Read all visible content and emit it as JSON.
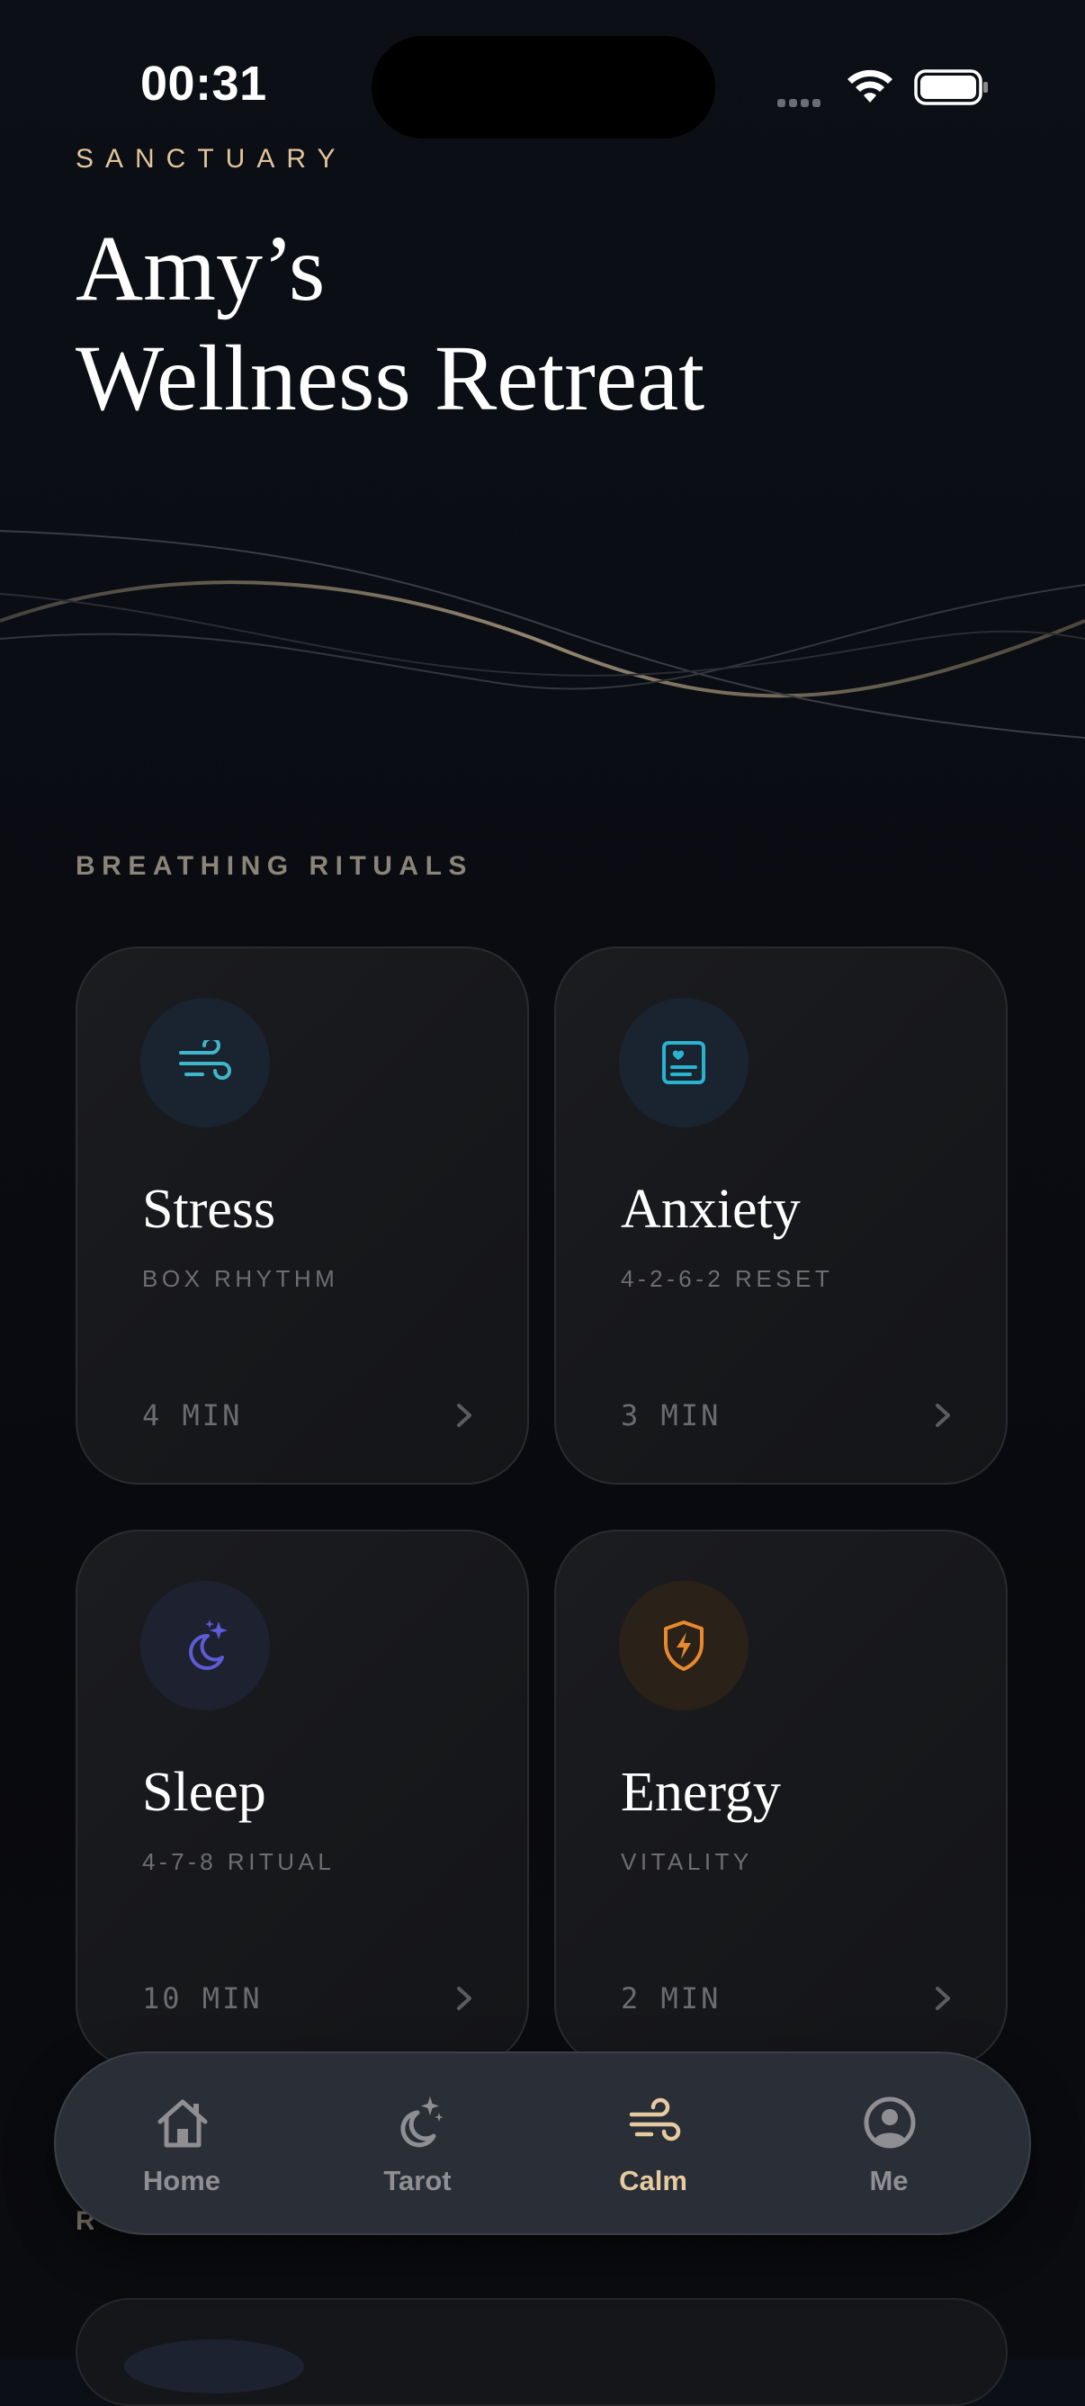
{
  "status_bar": {
    "time": "00:31"
  },
  "header": {
    "eyebrow": "SANCTUARY",
    "title_line1": "Amy’s",
    "title_line2": "Wellness Retreat"
  },
  "section": {
    "label": "BREATHING RITUALS"
  },
  "rituals": [
    {
      "title": "Stress",
      "subtitle": "BOX RHYTHM",
      "duration": "4 MIN",
      "icon": "wind-icon",
      "color": "#3fb6c9"
    },
    {
      "title": "Anxiety",
      "subtitle": "4-2-6-2 RESET",
      "duration": "3 MIN",
      "icon": "heart-note-icon",
      "color": "#29b3cf"
    },
    {
      "title": "Sleep",
      "subtitle": "4-7-8 RITUAL",
      "duration": "10 MIN",
      "icon": "moon-stars-icon",
      "color": "#5d5bd6"
    },
    {
      "title": "Energy",
      "subtitle": "VITALITY",
      "duration": "2 MIN",
      "icon": "shield-bolt-icon",
      "color": "#e8892e"
    }
  ],
  "next_section": {
    "label_partial": "R"
  },
  "tabs": [
    {
      "label": "Home",
      "icon": "home-icon",
      "active": false
    },
    {
      "label": "Tarot",
      "icon": "moon-sparkle-icon",
      "active": false
    },
    {
      "label": "Calm",
      "icon": "wind-icon",
      "active": true
    },
    {
      "label": "Me",
      "icon": "profile-icon",
      "active": false
    }
  ],
  "colors": {
    "accent_gold": "#e6cba0",
    "background": "#0a0c12",
    "card": "#18191c",
    "tabbar": "#2a2e37"
  }
}
